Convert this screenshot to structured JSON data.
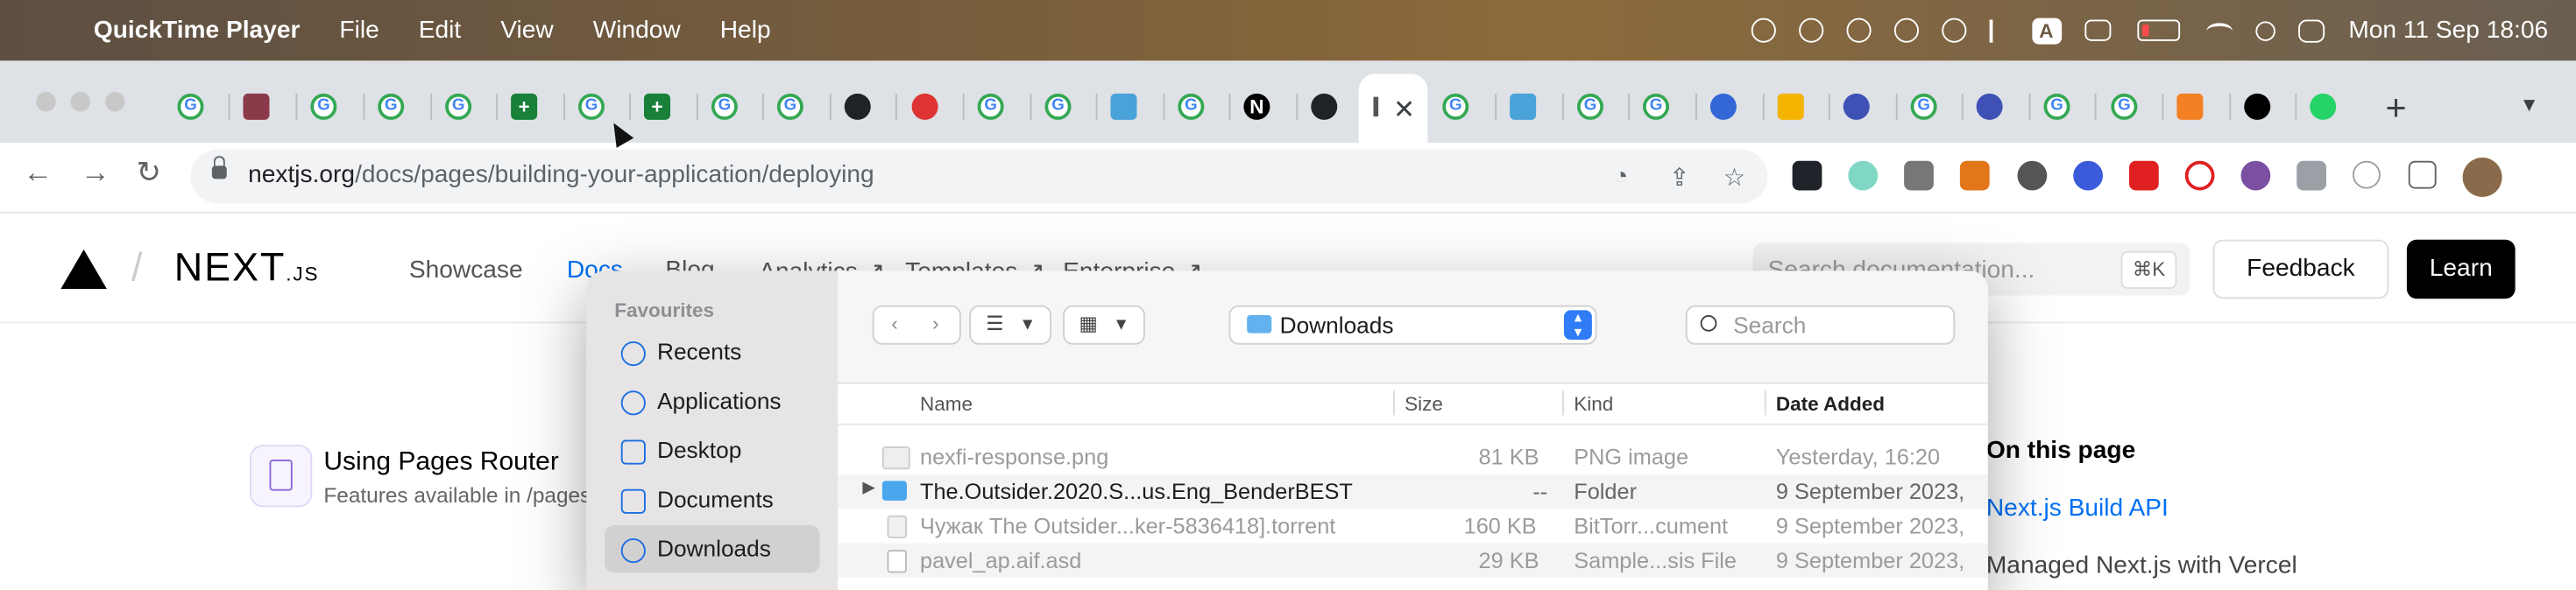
{
  "menubar": {
    "app_name": "QuickTime Player",
    "menus": [
      "File",
      "Edit",
      "View",
      "Window",
      "Help"
    ],
    "status_box_letter": "A",
    "clock": "Mon 11 Sep  18:06"
  },
  "browser": {
    "url_host": "nextjs.org",
    "url_path": "/docs/pages/building-your-application/deploying",
    "active_tab_close": "✕",
    "new_tab": "+"
  },
  "site": {
    "logo": "NEXT",
    "logo_suffix": ".JS",
    "nav": [
      "Showcase",
      "Docs",
      "Blog",
      "Analytics ↗",
      "Templates ↗",
      "Enterprise ↗"
    ],
    "search_placeholder": "Search documentation...",
    "search_shortcut": "⌘K",
    "feedback": "Feedback",
    "learn": "Learn",
    "card_title": "Using Pages Router",
    "card_subtitle": "Features available in /pages",
    "toc_title": "On this page",
    "toc_link": "Next.js Build API",
    "toc_text": "Managed Next.js with Vercel"
  },
  "dialog": {
    "sidebar_heading": "Favourites",
    "sidebar_items": [
      "Recents",
      "Applications",
      "Desktop",
      "Documents",
      "Downloads"
    ],
    "location": "Downloads",
    "search_placeholder": "Search",
    "columns": {
      "name": "Name",
      "size": "Size",
      "kind": "Kind",
      "date": "Date Added"
    },
    "files": [
      {
        "name": "nexfi-response.png",
        "size": "81 KB",
        "kind": "PNG image",
        "date": "Yesterday, 16:20"
      },
      {
        "name": "The.Outsider.2020.S...us.Eng_BenderBEST",
        "size": "--",
        "kind": "Folder",
        "date": "9 September 2023,"
      },
      {
        "name": "Чужак The Outsider...ker-5836418].torrent",
        "size": "160 KB",
        "kind": "BitTorr...cument",
        "date": "9 September 2023,"
      },
      {
        "name": "pavel_ap.aif.asd",
        "size": "29 KB",
        "kind": "Sample...sis File",
        "date": "9 September 2023,"
      }
    ]
  }
}
